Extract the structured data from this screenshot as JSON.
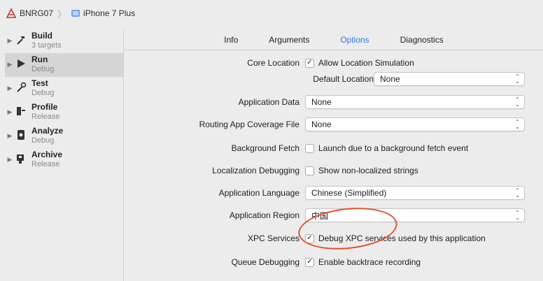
{
  "pathbar": {
    "project": "BNRG07",
    "device": "iPhone 7 Plus"
  },
  "sidebar": {
    "items": [
      {
        "title": "Build",
        "sub": "3 targets",
        "icon": "hammer-icon"
      },
      {
        "title": "Run",
        "sub": "Debug",
        "icon": "play-icon"
      },
      {
        "title": "Test",
        "sub": "Debug",
        "icon": "wrench-icon"
      },
      {
        "title": "Profile",
        "sub": "Release",
        "icon": "instruments-icon"
      },
      {
        "title": "Analyze",
        "sub": "Debug",
        "icon": "analyze-icon"
      },
      {
        "title": "Archive",
        "sub": "Release",
        "icon": "archive-icon"
      }
    ]
  },
  "tabs": [
    "Info",
    "Arguments",
    "Options",
    "Diagnostics"
  ],
  "options": {
    "core_location": {
      "label": "Core Location",
      "checkbox": "Allow Location Simulation",
      "checked": true
    },
    "default_location": {
      "label": "Default Location",
      "value": "None"
    },
    "application_data": {
      "label": "Application Data",
      "value": "None"
    },
    "routing_app": {
      "label": "Routing App Coverage File",
      "value": "None"
    },
    "background_fetch": {
      "label": "Background Fetch",
      "checkbox": "Launch due to a background fetch event",
      "checked": false
    },
    "localization_debugging": {
      "label": "Localization Debugging",
      "checkbox": "Show non-localized strings",
      "checked": false
    },
    "application_language": {
      "label": "Application Language",
      "value": "Chinese (Simplified)"
    },
    "application_region": {
      "label": "Application Region",
      "value": "中国"
    },
    "xpc_services": {
      "label": "XPC Services",
      "checkbox": "Debug XPC services used by this application",
      "checked": true
    },
    "queue_debugging": {
      "label": "Queue Debugging",
      "checkbox": "Enable backtrace recording",
      "checked": true
    }
  },
  "colors": {
    "accent": "#2b7be6",
    "annotation": "#e4502a"
  }
}
